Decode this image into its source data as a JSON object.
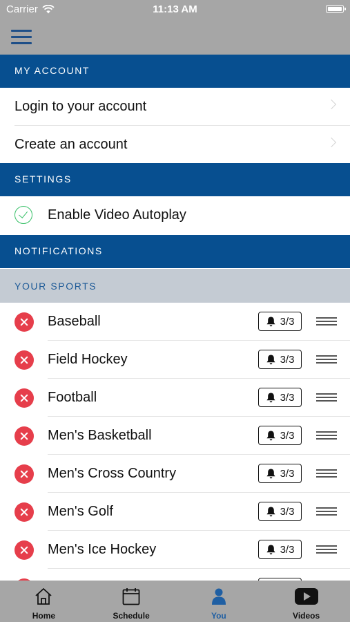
{
  "status_bar": {
    "carrier": "Carrier",
    "time": "11:13 AM"
  },
  "colors": {
    "section_bg": "#074f90",
    "subsection_bg": "#c4cbd3",
    "remove_red": "#e63e4b",
    "check_green": "#37c067",
    "active_tab": "#1f5fa3"
  },
  "my_account": {
    "header": "MY ACCOUNT",
    "items": [
      {
        "label": "Login to your account"
      },
      {
        "label": "Create an account"
      }
    ]
  },
  "settings": {
    "header": "SETTINGS",
    "autoplay": {
      "label": "Enable Video Autoplay",
      "checked": true
    }
  },
  "notifications": {
    "header": "NOTIFICATIONS",
    "subheader": "YOUR SPORTS",
    "sports": [
      {
        "name": "Baseball",
        "alerts": "3/3"
      },
      {
        "name": "Field Hockey",
        "alerts": "3/3"
      },
      {
        "name": "Football",
        "alerts": "3/3"
      },
      {
        "name": "Men's Basketball",
        "alerts": "3/3"
      },
      {
        "name": "Men's Cross Country",
        "alerts": "3/3"
      },
      {
        "name": "Men's Golf",
        "alerts": "3/3"
      },
      {
        "name": "Men's Ice Hockey",
        "alerts": "3/3"
      },
      {
        "name": "",
        "alerts": ""
      }
    ]
  },
  "tab_bar": {
    "tabs": [
      {
        "label": "Home",
        "icon": "home-icon",
        "active": false
      },
      {
        "label": "Schedule",
        "icon": "calendar-icon",
        "active": false
      },
      {
        "label": "You",
        "icon": "person-icon",
        "active": true
      },
      {
        "label": "Videos",
        "icon": "play-icon",
        "active": false
      }
    ]
  }
}
